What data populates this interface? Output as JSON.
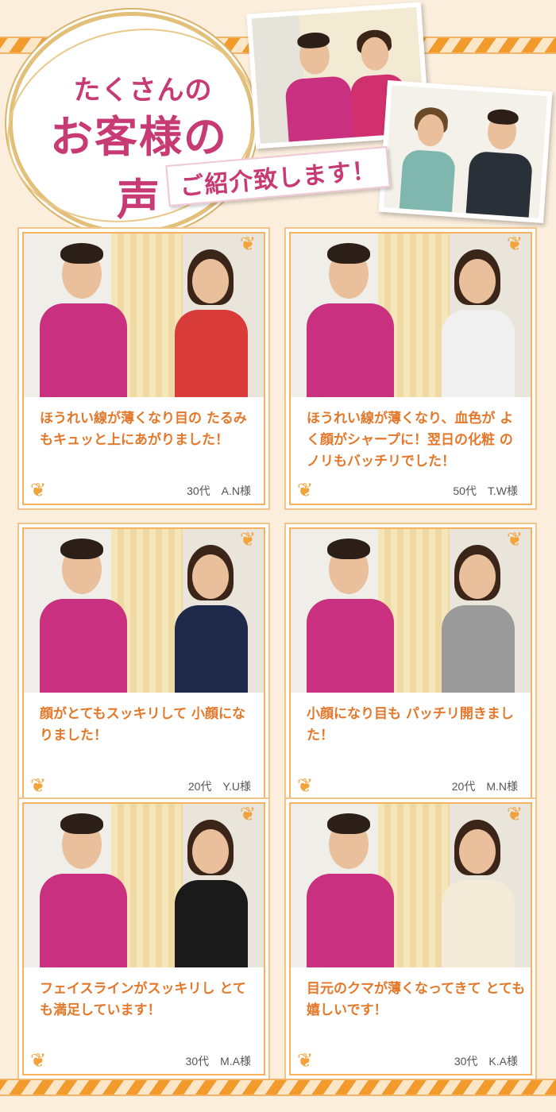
{
  "header": {
    "line1": "たくさんの",
    "line2": "お客様の声",
    "banner": "ご紹介致します！"
  },
  "ornament": "❦",
  "cards": [
    {
      "quote": "ほうれい線が薄くなり目の たるみもキュッと上にあがりました！",
      "sig": "30代　A.N様",
      "woman_color": "#d93a3a"
    },
    {
      "quote": "ほうれい線が薄くなり、血色が よく顔がシャープに！翌日の化粧 のノリもバッチリでした！",
      "sig": "50代　T.W様",
      "woman_color": "#f0f0f0"
    },
    {
      "quote": "顔がとてもスッキリして 小顔になりました！",
      "sig": "20代　Y.U様",
      "woman_color": "#1f2a4a"
    },
    {
      "quote": "小顔になり目も パッチリ開きました！",
      "sig": "20代　M.N様",
      "woman_color": "#9a9a9a"
    },
    {
      "quote": "フェイスラインがスッキリし とても満足しています！",
      "sig": "30代　M.A様",
      "woman_color": "#1a1a1a"
    },
    {
      "quote": "目元のクマが薄くなってきて とても嬉しいです！",
      "sig": "30代　K.A様",
      "woman_color": "#f4ead8"
    }
  ]
}
